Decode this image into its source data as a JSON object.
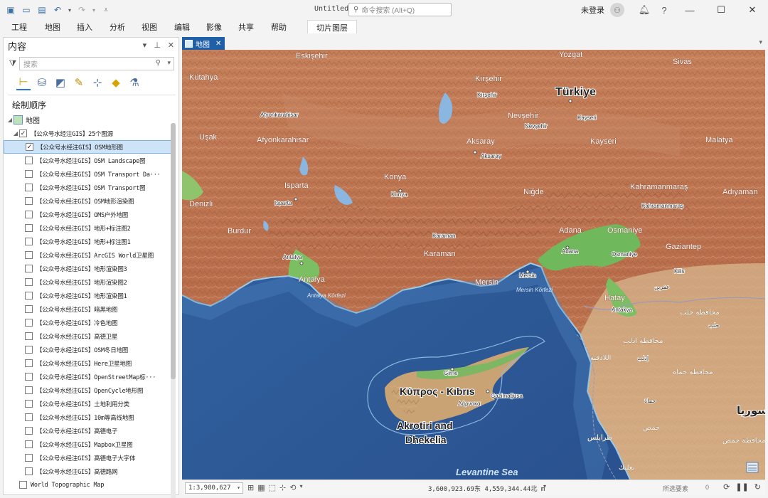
{
  "titlebar": {
    "document_title": "Untitled",
    "search_placeholder": "命令搜索 (Alt+Q)",
    "signin_label": "未登录",
    "quick_access_icons": [
      "new-project-icon",
      "open-project-icon",
      "save-project-icon",
      "undo-icon",
      "redo-icon",
      "customize-icon"
    ]
  },
  "ribbon": {
    "tabs": [
      "工程",
      "地图",
      "插入",
      "分析",
      "视图",
      "编辑",
      "影像",
      "共享",
      "帮助"
    ],
    "contextual_tab": "切片图层"
  },
  "contents": {
    "title": "内容",
    "search_placeholder": "搜索",
    "section_title": "绘制顺序",
    "map_node": "地图",
    "group_node": "【公众号水经注GIS】25个图源",
    "layers": [
      {
        "label": "【公众号水经注GIS】OSM地形图",
        "checked": true,
        "selected": true
      },
      {
        "label": "【公众号水经注GIS】OSM Landscape图",
        "checked": false
      },
      {
        "label": "【公众号水经注GIS】OSM Transport Da···",
        "checked": false
      },
      {
        "label": "【公众号水经注GIS】OSM Transport图",
        "checked": false
      },
      {
        "label": "【公众号水经注GIS】OSM地形渲染图",
        "checked": false
      },
      {
        "label": "【公众号水经注GIS】OMS户外地图",
        "checked": false
      },
      {
        "label": "【公众号水经注GIS】地形+标注图2",
        "checked": false
      },
      {
        "label": "【公众号水经注GIS】地形+标注图1",
        "checked": false
      },
      {
        "label": "【公众号水经注GIS】ArcGIS World卫星图",
        "checked": false
      },
      {
        "label": "【公众号水经注GIS】地形渲染图3",
        "checked": false
      },
      {
        "label": "【公众号水经注GIS】地形渲染图2",
        "checked": false
      },
      {
        "label": "【公众号水经注GIS】地形渲染图1",
        "checked": false
      },
      {
        "label": "【公众号水经注GIS】暗黑地图",
        "checked": false
      },
      {
        "label": "【公众号水经注GIS】冷色地图",
        "checked": false
      },
      {
        "label": "【公众号水经注GIS】高德卫星",
        "checked": false
      },
      {
        "label": "【公众号水经注GIS】OSM冬日地图",
        "checked": false
      },
      {
        "label": "【公众号水经注GIS】Here卫星地图",
        "checked": false
      },
      {
        "label": "【公众号水经注GIS】OpenStreetMap标···",
        "checked": false
      },
      {
        "label": "【公众号水经注GIS】OpenCycle地形图",
        "checked": false
      },
      {
        "label": "【公众号水经注GIS】土地利用分类",
        "checked": false
      },
      {
        "label": "【公众号水经注GIS】10m等高线地图",
        "checked": false
      },
      {
        "label": "【公众号水经注GIS】高德电子",
        "checked": false
      },
      {
        "label": "【公众号水经注GIS】Mapbox卫星图",
        "checked": false
      },
      {
        "label": "【公众号水经注GIS】高德电子大字体",
        "checked": false
      },
      {
        "label": "【公众号水经注GIS】高德路网",
        "checked": false
      }
    ],
    "basemap_layer": "World Topographic Map"
  },
  "map_view": {
    "tab_label": "地图",
    "country_label": "Türkiye",
    "island_label": "Κύπρος - Kıbrıs",
    "akrotiri_line1": "Akrotiri and",
    "akrotiri_line2": "Dhekelia",
    "sea_label": "Levantine Sea",
    "gulf_antalya": "Antalya Körfezi",
    "gulf_mersin": "Mersin Körfezi",
    "cities_large": [
      "Eskişehir",
      "Yozgat",
      "Sivas",
      "Kütahya",
      "Kırşehir",
      "Uşak",
      "Afyonkarahisar",
      "Nevşehir",
      "Aksaray",
      "Kayseri",
      "Malatya",
      "Konya",
      "Isparta",
      "Niğde",
      "Kahramanmaraş",
      "Adıyaman",
      "Denizli",
      "Burdur",
      "Adana",
      "Osmaniye",
      "Gaziantep",
      "Karaman",
      "Antalya",
      "Mersin",
      "Hatay"
    ],
    "cities_small": [
      "Kırşehir",
      "Afyonkarahisar",
      "Nevşehir",
      "Kayseri",
      "Aksaray",
      "Konya",
      "Isparta",
      "Kahramanmaraş",
      "Karaman",
      "Antalya",
      "Adana",
      "Osmaniye",
      "Mersin",
      "Girne",
      "Gazimağusa",
      "Λάρνακα",
      "Antakya",
      "Kilis"
    ],
    "arabic_labels": [
      "محافظة حلب",
      "محافظة ادلب",
      "اللاذقية",
      "محافظة حماة",
      "حمص",
      "طرابلس",
      "محافظة حمص",
      "بعلبك",
      "سوريا",
      "حلب",
      "إدلب",
      "حماة",
      "عفرين"
    ]
  },
  "statusbar": {
    "scale": "1:3,980,627",
    "coordinates": "3,600,923.69东 4,559,344.44北 m",
    "selected_features_label": "所选要素",
    "selected_count": "0"
  }
}
